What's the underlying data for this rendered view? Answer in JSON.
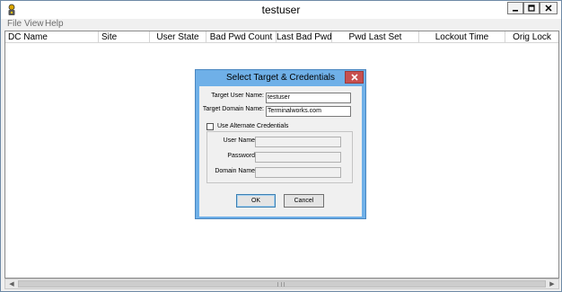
{
  "window": {
    "title": "testuser"
  },
  "menu": [
    "File",
    "View",
    "Help"
  ],
  "columns": [
    "DC Name",
    "Site",
    "User State",
    "Bad Pwd Count",
    "Last Bad Pwd",
    "Pwd Last Set",
    "Lockout Time",
    "Orig Lock"
  ],
  "dialog": {
    "title": "Select Target & Credentials",
    "target_user_label": "Target User Name:",
    "target_user_value": "testuser",
    "target_domain_label": "Target Domain Name:",
    "target_domain_value": "Terminalworks.com",
    "alt_credentials_label": "Use Alternate Credentials",
    "alt_credentials_checked": false,
    "user_name_label": "User Name:",
    "password_label": "Password:",
    "domain_name_label": "Domain Name:",
    "ok_label": "OK",
    "cancel_label": "Cancel"
  },
  "colors": {
    "dialog_frame": "#6fb0e8",
    "close_button": "#c75050",
    "desktop": "#b9d1ea"
  }
}
